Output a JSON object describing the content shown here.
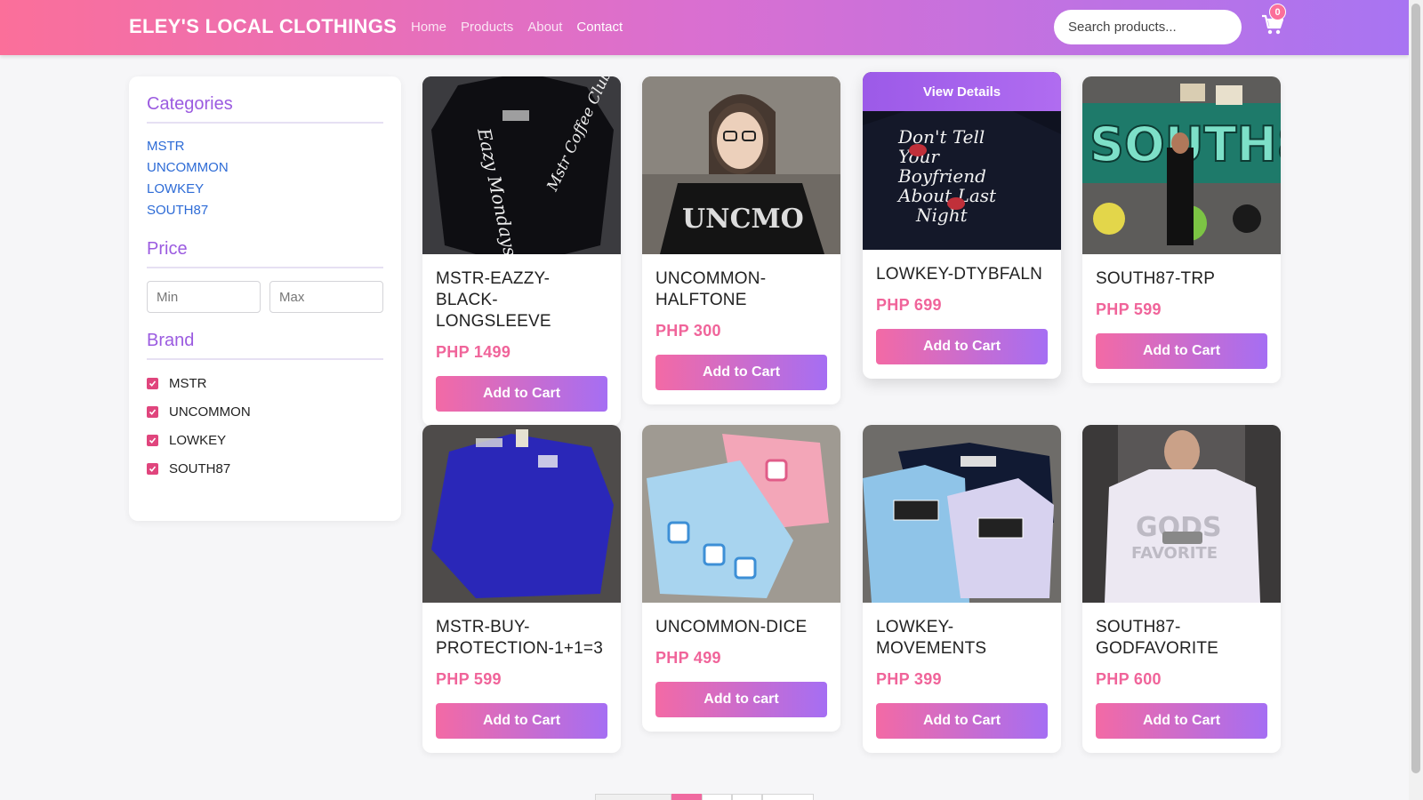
{
  "header": {
    "brand": "ELEY'S LOCAL CLOTHINGS",
    "nav": [
      "Home",
      "Products",
      "About",
      "Contact"
    ],
    "search_placeholder": "Search products...",
    "cart_count": "0",
    "icons": {
      "cart": "cart-icon"
    }
  },
  "sidebar": {
    "categories_title": "Categories",
    "categories": [
      "MSTR",
      "UNCOMMON",
      "LOWKEY",
      "SOUTH87"
    ],
    "price_title": "Price",
    "price_min_placeholder": "Min",
    "price_max_placeholder": "Max",
    "brand_title": "Brand",
    "brands": [
      {
        "label": "MSTR",
        "checked": true
      },
      {
        "label": "UNCOMMON",
        "checked": true
      },
      {
        "label": "LOWKEY",
        "checked": true
      },
      {
        "label": "SOUTH87",
        "checked": true
      }
    ]
  },
  "products": [
    {
      "name": "MSTR-EAZZY-BLACK-LONGSLEEVE",
      "price": "PHP 1499",
      "button": "Add to Cart"
    },
    {
      "name": "UNCOMMON-HALFTONE",
      "price": "PHP 300",
      "button": "Add to Cart"
    },
    {
      "name": "LOWKEY-DTYBFALN",
      "price": "PHP 699",
      "button": "Add to Cart",
      "overlay": "View Details"
    },
    {
      "name": "SOUTH87-TRP",
      "price": "PHP 599",
      "button": "Add to Cart"
    },
    {
      "name": "MSTR-BUY-PROTECTION-1+1=3",
      "price": "PHP 599",
      "button": "Add to Cart"
    },
    {
      "name": "UNCOMMON-DICE",
      "price": "PHP 499",
      "button": "Add to cart"
    },
    {
      "name": "LOWKEY-MOVEMENTS",
      "price": "PHP 399",
      "button": "Add to Cart"
    },
    {
      "name": "SOUTH87-GODFAVORITE",
      "price": "PHP 600",
      "button": "Add to Cart"
    }
  ],
  "colors": {
    "header_gradient_start": "#fb6f9a",
    "header_gradient_end": "#a874f2",
    "price": "#f0649a",
    "heading": "#9b5be0",
    "link": "#2d6bd6"
  }
}
